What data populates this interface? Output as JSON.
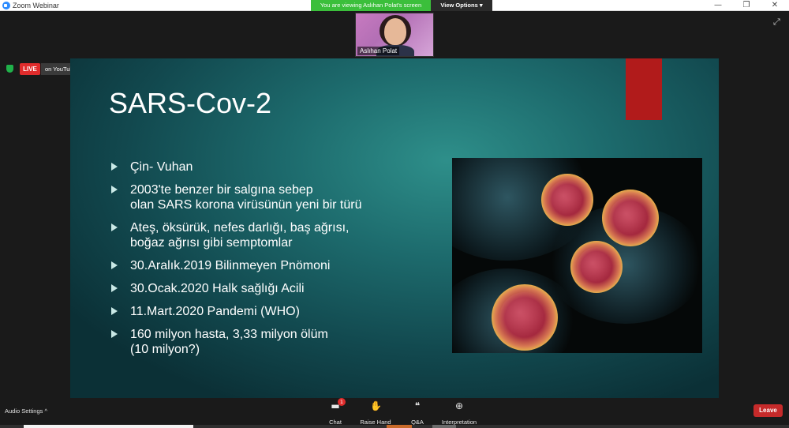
{
  "window": {
    "title": "Zoom Webinar",
    "controls": [
      "—",
      "❐",
      "✕"
    ]
  },
  "banner": {
    "viewing_text": "You are viewing Aslıhan Polat's screen",
    "view_options_label": "View Options ▾"
  },
  "speaker": {
    "name": "Aslıhan Polat"
  },
  "live": {
    "badge": "LIVE",
    "platform": "on YouTube"
  },
  "slide": {
    "title": "SARS-Cov-2",
    "bullets": [
      "Çin- Vuhan",
      " 2003'te benzer bir salgına sebep\nolan SARS korona virüsünün yeni bir türü",
      "Ateş, öksürük, nefes darlığı, baş ağrısı,\nboğaz ağrısı gibi semptomlar",
      "30.Aralık.2019 Bilinmeyen Pnömoni",
      "30.Ocak.2020 Halk sağlığı Acili",
      "11.Mart.2020  Pandemi (WHO)",
      "160 milyon hasta, 3,33 milyon ölüm\n(10 milyon?)"
    ],
    "accent_color": "#b11b1b"
  },
  "toolbar": {
    "audio_settings": "Audio Settings ^",
    "chat_label": "Chat",
    "chat_badge": "1",
    "raise_hand_label": "Raise Hand",
    "qa_label": "Q&A",
    "interpretation_label": "Interpretation",
    "leave_label": "Leave"
  },
  "colors": {
    "live_red": "#e02c2c",
    "banner_green": "#3bbf3b",
    "leave_red": "#c62a2a"
  }
}
